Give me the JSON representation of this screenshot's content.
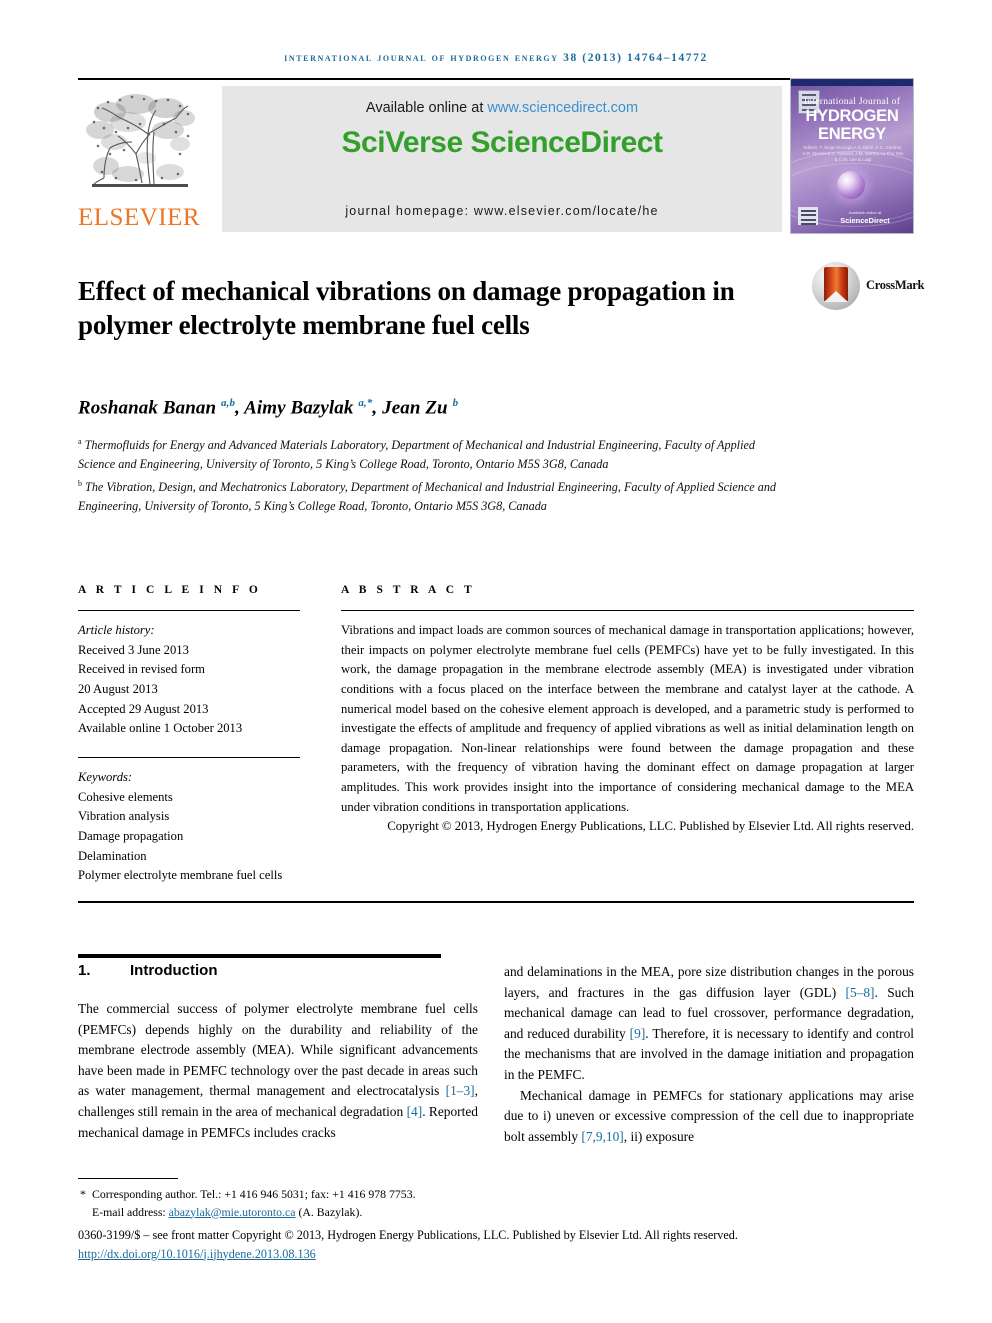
{
  "running_head": "International Journal of Hydrogen Energy 38 (2013) 14764–14772",
  "masthead": {
    "publisher_name": "ELSEVIER",
    "available_prefix": "Available online at ",
    "available_link": "www.sciencedirect.com",
    "brand": "SciVerse ScienceDirect",
    "homepage": "journal homepage: www.elsevier.com/locate/he"
  },
  "cover": {
    "line1": "International Journal of",
    "line2": "HYDROGEN",
    "line3": "ENERGY",
    "editors": "Editors: T. Nejat Veziroglu  •  S. Bahri, E.C. Gardner, H.R. Morcks\nE.C. Ferreira, J.M. Martins\nLa Thu Tam & C.W. Lee & Luigi",
    "footer_note": "Available online at",
    "footer_brand": "ScienceDirect"
  },
  "article": {
    "title": "Effect of mechanical vibrations on damage propagation in polymer electrolyte membrane fuel cells",
    "crossmark_label": "CrossMark",
    "authors_html": "Roshanak Banan <sup>a,b</sup>, Aimy Bazylak <sup>a,</sup><sup>*</sup>, Jean Zu <sup>b</sup>",
    "affiliations": [
      "<sup>a</sup> Thermofluids for Energy and Advanced Materials Laboratory, Department of Mechanical and Industrial Engineering, Faculty of Applied Science and Engineering, University of Toronto, 5 King’s College Road, Toronto, Ontario M5S 3G8, Canada",
      "<sup>b</sup> The Vibration, Design, and Mechatronics Laboratory, Department of Mechanical and Industrial Engineering, Faculty of Applied Science and Engineering, University of Toronto, 5 King’s College Road, Toronto, Ontario M5S 3G8, Canada"
    ]
  },
  "article_info": {
    "heading": "A R T I C L E    I N F O",
    "history_label": "Article history:",
    "history": [
      "Received 3 June 2013",
      "Received in revised form",
      "20 August 2013",
      "Accepted 29 August 2013",
      "Available online 1 October 2013"
    ],
    "keywords_label": "Keywords:",
    "keywords": [
      "Cohesive elements",
      "Vibration analysis",
      "Damage propagation",
      "Delamination",
      "Polymer electrolyte membrane fuel cells"
    ]
  },
  "abstract": {
    "heading": "A B S T R A C T",
    "body": "Vibrations and impact loads are common sources of mechanical damage in transportation applications; however, their impacts on polymer electrolyte membrane fuel cells (PEMFCs) have yet to be fully investigated. In this work, the damage propagation in the membrane electrode assembly (MEA) is investigated under vibration conditions with a focus placed on the interface between the membrane and catalyst layer at the cathode. A numerical model based on the cohesive element approach is developed, and a parametric study is performed to investigate the effects of amplitude and frequency of applied vibrations as well as initial delamination length on damage propagation. Non-linear relationships were found between the damage propagation and these parameters, with the frequency of vibration having the dominant effect on damage propagation at larger amplitudes. This work provides insight into the importance of considering mechanical damage to the MEA under vibration conditions in transportation applications.",
    "copyright": "Copyright © 2013, Hydrogen Energy Publications, LLC. Published by Elsevier Ltd. All rights reserved."
  },
  "body": {
    "section_number": "1.",
    "section_title": "Introduction",
    "left_paragraphs_html": [
      "The commercial success of polymer electrolyte membrane fuel cells (PEMFCs) depends highly on the durability and reliability of the membrane electrode assembly (MEA). While significant advancements have been made in PEMFC technology over the past decade in areas such as water management, thermal management and electrocatalysis <span class=\"ref\">[1–3]</span>, challenges still remain in the area of mechanical degradation <span class=\"ref\">[4]</span>. Reported mechanical damage in PEMFCs includes cracks"
    ],
    "right_paragraphs_html": [
      "and delaminations in the MEA, pore size distribution changes in the porous layers, and fractures in the gas diffusion layer (GDL) <span class=\"ref\">[5–8]</span>. Such mechanical damage can lead to fuel crossover, performance degradation, and reduced durability <span class=\"ref\">[9]</span>. Therefore, it is necessary to identify and control the mechanisms that are involved in the damage initiation and propagation in the PEMFC.",
      "Mechanical damage in PEMFCs for stationary applications may arise due to i) uneven or excessive compression of the cell due to inappropriate bolt assembly <span class=\"ref\">[7,9,10]</span>, ii) exposure"
    ]
  },
  "footer": {
    "corresponding_marker": "*",
    "corresponding_line": "Corresponding author. Tel.: +1 416 946 5031; fax: +1 416 978 7753.",
    "email_label": "E-mail address: ",
    "email": "abazylak@mie.utoronto.ca",
    "email_suffix": " (A. Bazylak).",
    "imprint": "0360-3199/$ – see front matter Copyright © 2013, Hydrogen Energy Publications, LLC. Published by Elsevier Ltd. All rights reserved.",
    "doi": "http://dx.doi.org/10.1016/j.ijhydene.2013.08.136"
  },
  "colors": {
    "link_blue": "#1a6b9c",
    "sciencedirect_green": "#33a02c",
    "elsevier_orange": "#ee7623",
    "running_head_blue": "#1a6b9c"
  }
}
